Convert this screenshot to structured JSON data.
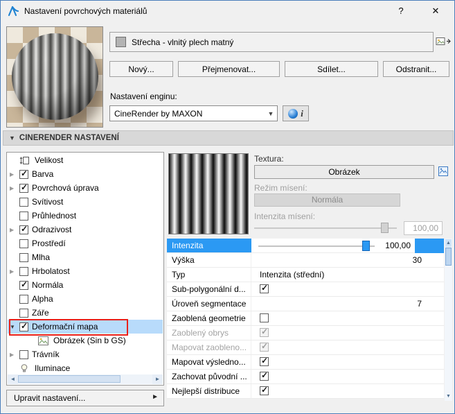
{
  "window": {
    "title": "Nastavení povrchových materiálů",
    "help_label": "?",
    "close_label": "✕"
  },
  "material": {
    "name": "Střecha - vlnitý plech matný",
    "buttons": {
      "new": "Nový...",
      "rename": "Přejmenovat...",
      "share": "Sdílet...",
      "remove": "Odstranit..."
    },
    "engine_label": "Nastavení enginu:",
    "engine_value": "CineRender by MAXON",
    "engine_info": "i"
  },
  "section_header": "CINERENDER NASTAVENÍ",
  "tree": {
    "items": [
      {
        "label": "Velikost",
        "icon": "size-icon"
      },
      {
        "label": "Barva",
        "expand": "collapsed",
        "checked": true
      },
      {
        "label": "Povrchová úprava",
        "expand": "collapsed",
        "checked": true
      },
      {
        "label": "Svítivost",
        "checked": false
      },
      {
        "label": "Průhlednost",
        "checked": false
      },
      {
        "label": "Odrazivost",
        "expand": "collapsed",
        "checked": true
      },
      {
        "label": "Prostředí",
        "checked": false
      },
      {
        "label": "Mlha",
        "checked": false
      },
      {
        "label": "Hrbolatost",
        "expand": "collapsed",
        "checked": false
      },
      {
        "label": "Normála",
        "checked": true
      },
      {
        "label": "Alpha",
        "checked": false
      },
      {
        "label": "Záře",
        "checked": false
      },
      {
        "label": "Deformační mapa",
        "expand": "expanded",
        "checked": true,
        "selected": true,
        "annotated": true
      },
      {
        "label": "Obrázek (Sin b GS)",
        "icon": "image-icon",
        "indent": 1
      },
      {
        "label": "Trávník",
        "expand": "collapsed",
        "checked": false
      },
      {
        "label": "Iluminace",
        "icon": "illumination-icon"
      }
    ],
    "edit_button": "Upravit nastavení..."
  },
  "texture_panel": {
    "texture_label": "Textura:",
    "texture_button": "Obrázek",
    "blend_mode_label": "Režim mísení:",
    "blend_mode_value": "Normála",
    "blend_intensity_label": "Intenzita mísení:",
    "blend_intensity_value": "100,00"
  },
  "properties": {
    "rows": [
      {
        "label": "Intenzita",
        "type": "slider",
        "value": "100,00",
        "selected": true
      },
      {
        "label": "Výška",
        "type": "number",
        "value": "30"
      },
      {
        "label": "Typ",
        "type": "text",
        "value": "Intenzita (střední)"
      },
      {
        "label": "Sub-polygonální d...",
        "type": "checkbox",
        "checked": true
      },
      {
        "label": "Úroveň segmentace",
        "type": "number",
        "value": "7"
      },
      {
        "label": "Zaoblená geometrie",
        "type": "checkbox",
        "checked": false
      },
      {
        "label": "Zaoblený obrys",
        "type": "checkbox",
        "checked": true,
        "disabled": true
      },
      {
        "label": "Mapovat zaobleno...",
        "type": "checkbox",
        "checked": true,
        "disabled": true
      },
      {
        "label": "Mapovat výsledno...",
        "type": "checkbox",
        "checked": true
      },
      {
        "label": "Zachovat původní ...",
        "type": "checkbox",
        "checked": true
      },
      {
        "label": "Nejlepší distribuce",
        "type": "checkbox",
        "checked": true
      }
    ]
  },
  "colors": {
    "accent": "#2b99f3",
    "selection": "#b8dbfb",
    "annotation": "#e8201a"
  }
}
